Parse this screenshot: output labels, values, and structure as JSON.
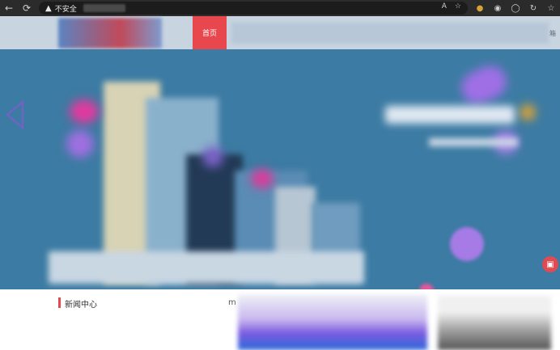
{
  "browser": {
    "security_label": "不安全",
    "address_text": ""
  },
  "header": {
    "home_tab": "首页",
    "menu_edge_text": "箱"
  },
  "hero": {
    "fab_icon": "inbox-icon"
  },
  "news": {
    "section_title": "新闻中心",
    "more_text": "m"
  },
  "colors": {
    "accent": "#e8474e",
    "hero_bg": "#3c7ba3",
    "header_bg": "#c8d4e0"
  }
}
